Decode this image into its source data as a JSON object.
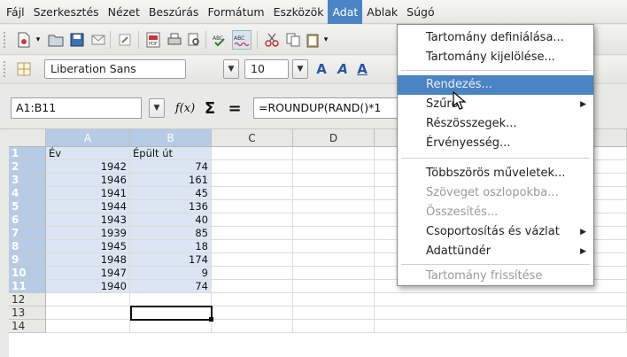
{
  "menubar": {
    "items": [
      {
        "label": "Fájl"
      },
      {
        "label": "Szerkesztés"
      },
      {
        "label": "Nézet"
      },
      {
        "label": "Beszúrás"
      },
      {
        "label": "Formátum"
      },
      {
        "label": "Eszközök"
      },
      {
        "label": "Adat"
      },
      {
        "label": "Ablak"
      },
      {
        "label": "Súgó"
      }
    ]
  },
  "toolbar": {
    "font_name": "Liberation Sans",
    "font_size": "10"
  },
  "formula_bar": {
    "name_box": "A1:B11",
    "function_icon": "f(x)",
    "sum_icon": "Σ",
    "equals_icon": "=",
    "formula": "=ROUNDUP(RAND()*1"
  },
  "sheet": {
    "columns": [
      "A",
      "B",
      "C",
      "D"
    ],
    "rows": [
      {
        "num": "1",
        "a": "Év",
        "b": "Épült út"
      },
      {
        "num": "2",
        "a": "1942",
        "b": "74"
      },
      {
        "num": "3",
        "a": "1946",
        "b": "161"
      },
      {
        "num": "4",
        "a": "1941",
        "b": "45"
      },
      {
        "num": "5",
        "a": "1944",
        "b": "136"
      },
      {
        "num": "6",
        "a": "1943",
        "b": "40"
      },
      {
        "num": "7",
        "a": "1939",
        "b": "85"
      },
      {
        "num": "8",
        "a": "1945",
        "b": "18"
      },
      {
        "num": "9",
        "a": "1948",
        "b": "174"
      },
      {
        "num": "10",
        "a": "1947",
        "b": "9"
      },
      {
        "num": "11",
        "a": "1940",
        "b": "74"
      },
      {
        "num": "12",
        "a": "",
        "b": ""
      },
      {
        "num": "13",
        "a": "",
        "b": ""
      },
      {
        "num": "14",
        "a": "",
        "b": ""
      }
    ]
  },
  "data_menu": {
    "items": [
      {
        "label": "Tartomány definiálása...",
        "enabled": true
      },
      {
        "label": "Tartomány kijelölése...",
        "enabled": true
      },
      {
        "label": "Rendezés...",
        "enabled": true,
        "highlighted": true
      },
      {
        "label": "Szűrő",
        "enabled": true,
        "submenu": true
      },
      {
        "label": "Részösszegek...",
        "enabled": true
      },
      {
        "label": "Érvényesség...",
        "enabled": true
      },
      {
        "label": "Többszörös műveletek...",
        "enabled": true
      },
      {
        "label": "Szöveget oszlopokba...",
        "enabled": false
      },
      {
        "label": "Összesítés...",
        "enabled": false
      },
      {
        "label": "Csoportosítás és vázlat",
        "enabled": true,
        "submenu": true
      },
      {
        "label": "Adattündér",
        "enabled": true,
        "submenu": true
      },
      {
        "label": "Tartomány frissítése",
        "enabled": false
      }
    ]
  },
  "colors": {
    "menu_highlight": "#4a84c4",
    "selection_fill": "#dbe5f3",
    "selected_header": "#b6cbe6"
  }
}
